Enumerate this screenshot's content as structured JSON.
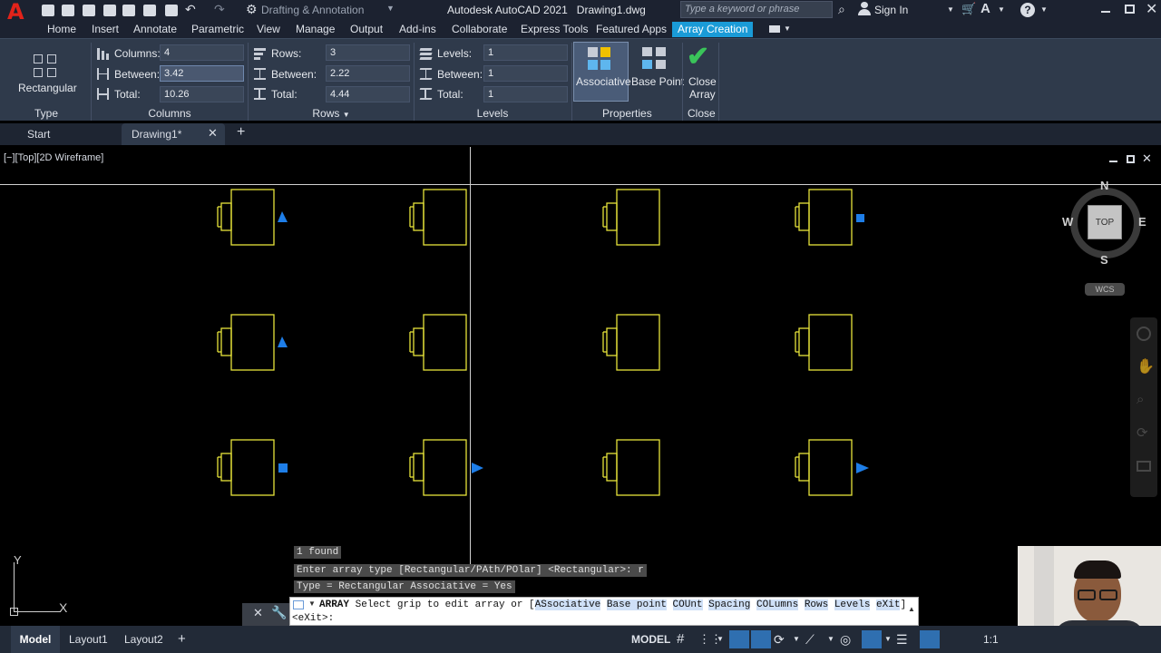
{
  "app": {
    "logo_letter": "A",
    "title": "Autodesk AutoCAD 2021",
    "document": "Drawing1.dwg"
  },
  "quick_access": {
    "workspace": "Drafting & Annotation"
  },
  "search": {
    "placeholder": "Type a keyword or phrase"
  },
  "user": {
    "sign_in": "Sign In"
  },
  "menu": {
    "items": [
      "Home",
      "Insert",
      "Annotate",
      "Parametric",
      "View",
      "Manage",
      "Output",
      "Add-ins",
      "Collaborate",
      "Express Tools",
      "Featured Apps",
      "Array Creation"
    ],
    "active": "Array Creation"
  },
  "ribbon": {
    "type_panel": {
      "button": "Rectangular",
      "title": "Type"
    },
    "columns_panel": {
      "title": "Columns",
      "columns_label": "Columns:",
      "columns_value": "4",
      "between_label": "Between:",
      "between_value": "3.42",
      "total_label": "Total:",
      "total_value": "10.26"
    },
    "rows_panel": {
      "title": "Rows",
      "rows_label": "Rows:",
      "rows_value": "3",
      "between_label": "Between:",
      "between_value": "2.22",
      "total_label": "Total:",
      "total_value": "4.44"
    },
    "levels_panel": {
      "title": "Levels",
      "levels_label": "Levels:",
      "levels_value": "1",
      "between_label": "Between:",
      "between_value": "1",
      "total_label": "Total:",
      "total_value": "1"
    },
    "properties_panel": {
      "title": "Properties",
      "associative": "Associative",
      "base_point": "Base Point"
    },
    "close_panel": {
      "title": "Close",
      "close_line1": "Close",
      "close_line2": "Array"
    }
  },
  "doc_tabs": {
    "start": "Start",
    "drawing": "Drawing1*"
  },
  "viewport": {
    "label": "[−][Top][2D Wireframe]"
  },
  "viewcube": {
    "north": "N",
    "south": "S",
    "east": "E",
    "west": "W",
    "face": "TOP",
    "ucs": "WCS"
  },
  "ucs_icon": {
    "y": "Y",
    "x": "X"
  },
  "command": {
    "history": [
      "1 found",
      "Enter array type [Rectangular/PAth/POlar] <Rectangular>: r",
      "Type = Rectangular  Associative = Yes"
    ],
    "prompt_cmd": "ARRAY",
    "prompt_text": "Select grip to edit array or [",
    "options": [
      "ASsociative",
      "Base point",
      "COUnt",
      "Spacing",
      "COLumns",
      "Rows",
      "Levels",
      "eXit"
    ],
    "prompt_end": "]",
    "input": "<eXit>:"
  },
  "statusbar": {
    "model_tab": "Model",
    "layouts": [
      "Layout1",
      "Layout2"
    ],
    "model_space": "MODEL",
    "scale": "1:1"
  },
  "colors": {
    "accent": "#1a9bd7",
    "geometry": "#e6e33a",
    "grip": "#1e7ee8",
    "ribbon": "#2f3a4b"
  }
}
